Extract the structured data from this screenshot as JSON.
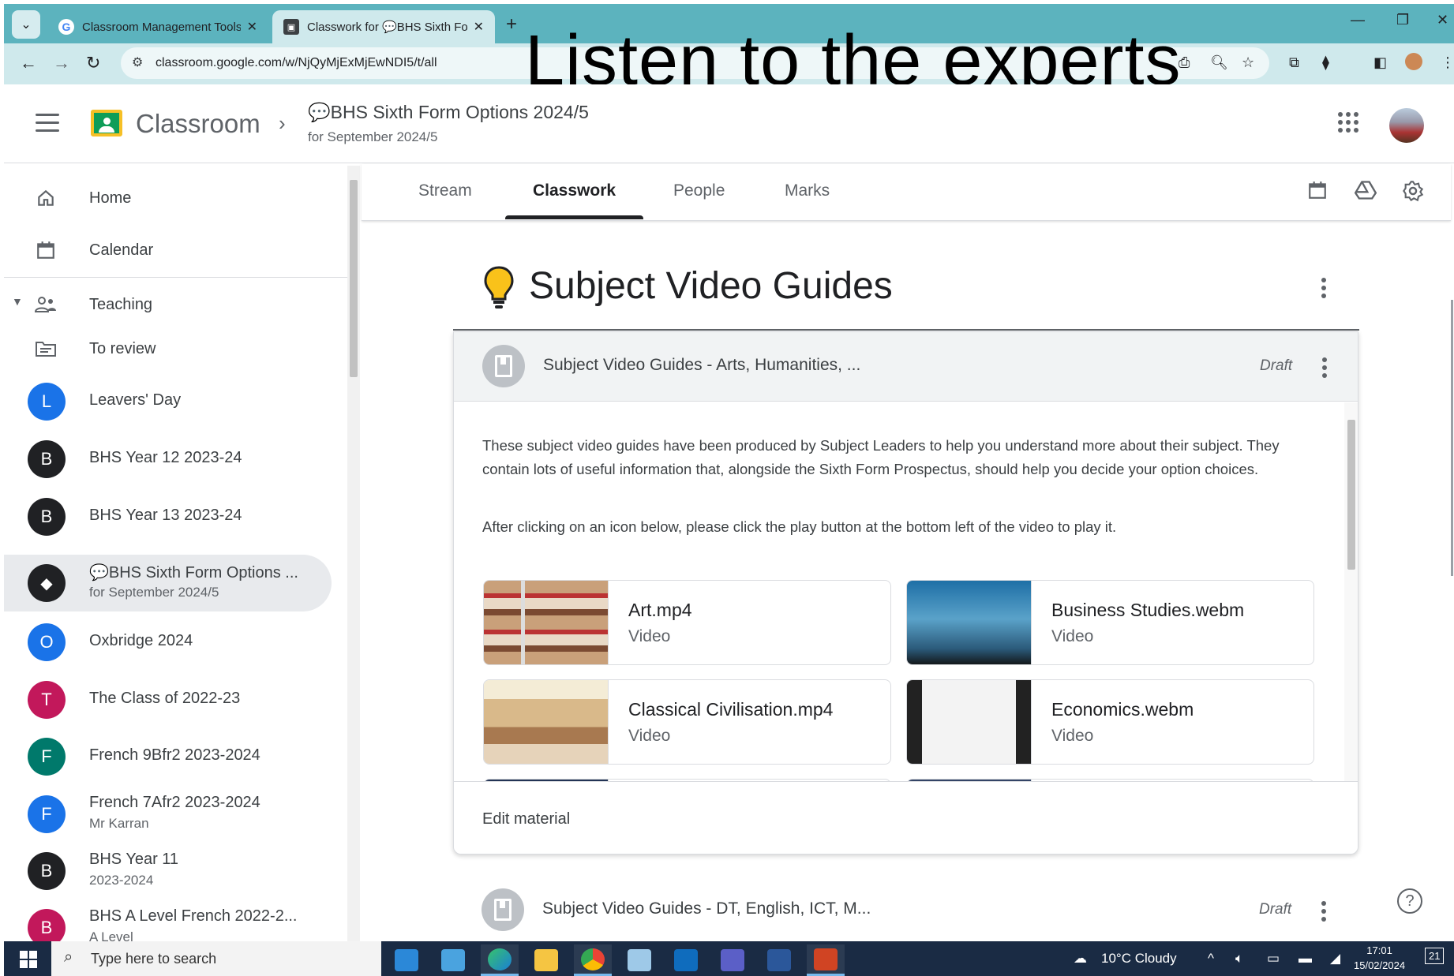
{
  "browser": {
    "tabs": [
      {
        "title": "Classroom Management Tools &",
        "active": false
      },
      {
        "title": "Classwork for 💬BHS Sixth Form",
        "active": true
      }
    ],
    "url": "classroom.google.com/w/NjQyMjExMjEwNDI5/t/all"
  },
  "overlay": {
    "text": "Listen to the experts"
  },
  "header": {
    "app_name": "Classroom",
    "class_title": "💬BHS Sixth Form Options 2024/5",
    "class_subtitle": "for September 2024/5"
  },
  "sidebar": {
    "home": "Home",
    "calendar": "Calendar",
    "teaching": "Teaching",
    "to_review": "To review",
    "classes": [
      {
        "initial": "L",
        "name": "Leavers' Day",
        "sub": "",
        "color": "#1a73e8"
      },
      {
        "initial": "B",
        "name": "BHS Year 12 2023-24",
        "sub": "",
        "color": "#202124"
      },
      {
        "initial": "B",
        "name": "BHS Year 13 2023-24",
        "sub": "",
        "color": "#202124"
      },
      {
        "initial": "◆",
        "name": "💬BHS Sixth Form Options ...",
        "sub": "for September 2024/5",
        "color": "#202124",
        "selected": true
      },
      {
        "initial": "O",
        "name": "Oxbridge 2024",
        "sub": "",
        "color": "#1a73e8"
      },
      {
        "initial": "T",
        "name": "The Class of 2022-23",
        "sub": "",
        "color": "#c2185b"
      },
      {
        "initial": "F",
        "name": "French 9Bfr2 2023-2024",
        "sub": "",
        "color": "#00796b"
      },
      {
        "initial": "F",
        "name": "French 7Afr2 2023-2024",
        "sub": "Mr Karran",
        "color": "#1a73e8"
      },
      {
        "initial": "B",
        "name": "BHS Year 11",
        "sub": "2023-2024",
        "color": "#202124"
      },
      {
        "initial": "B",
        "name": "BHS A Level French 2022-2...",
        "sub": "A Level",
        "color": "#c2185b"
      }
    ]
  },
  "class_tabs": [
    "Stream",
    "Classwork",
    "People",
    "Marks"
  ],
  "topic": {
    "title": "Subject Video Guides"
  },
  "material": {
    "title": "Subject Video Guides - Arts, Humanities, ...",
    "status": "Draft",
    "description_1": "These subject video guides have been produced by Subject Leaders to help you understand more about their subject. They contain lots of useful information that, alongside the Sixth Form Prospectus, should help you decide your option choices.",
    "description_2": "After clicking on an icon below, please click the play button at the bottom left of the video to play it.",
    "attachments": [
      {
        "name": "Art.mp4",
        "type": "Video"
      },
      {
        "name": "Business Studies.webm",
        "type": "Video"
      },
      {
        "name": "Classical Civilisation.mp4",
        "type": "Video"
      },
      {
        "name": "Economics.webm",
        "type": "Video"
      }
    ],
    "edit_label": "Edit material"
  },
  "next_material": {
    "title": "Subject Video Guides - DT, English, ICT, M...",
    "status": "Draft"
  },
  "taskbar": {
    "search_placeholder": "Type here to search",
    "weather": "10°C  Cloudy",
    "time": "17:01",
    "date": "15/02/2024",
    "notif_count": "21"
  },
  "colors": {
    "accent": "#1a73e8",
    "tab_strip": "#5cb3be",
    "taskbar": "#1a2b44"
  }
}
